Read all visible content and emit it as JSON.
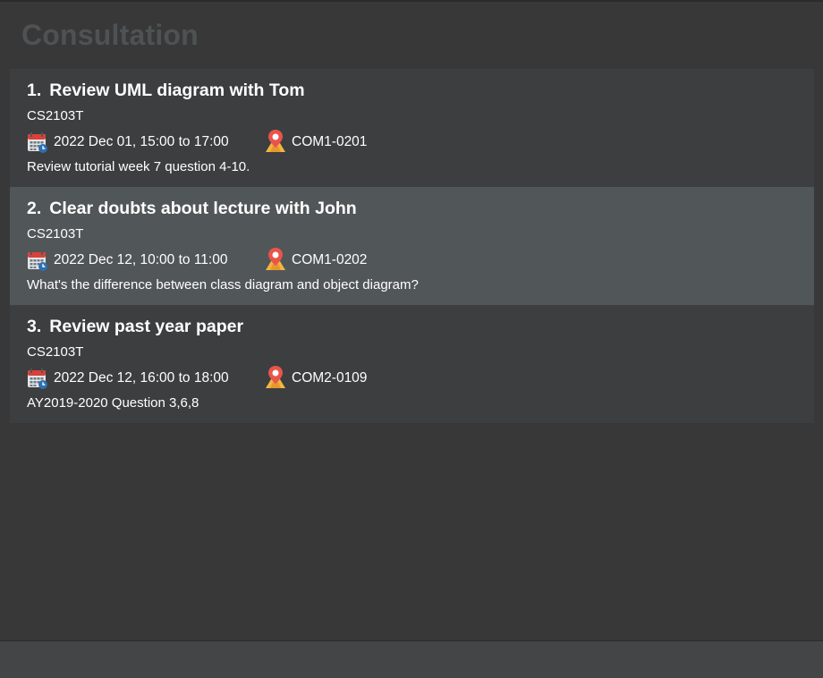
{
  "header": {
    "title": "Consultation"
  },
  "consultations": [
    {
      "index": "1.",
      "title": "Review UML diagram with Tom",
      "module": "CS2103T",
      "datetime": "2022 Dec 01, 15:00 to 17:00",
      "location": "COM1-0201",
      "description": "Review tutorial week 7 question 4-10.",
      "selected": false
    },
    {
      "index": "2.",
      "title": "Clear doubts about lecture with John",
      "module": "CS2103T",
      "datetime": "2022 Dec 12, 10:00 to 11:00",
      "location": "COM1-0202",
      "description": "What's the difference between class diagram and object diagram?",
      "selected": true
    },
    {
      "index": "3.",
      "title": "Review past year paper",
      "module": "CS2103T",
      "datetime": "2022 Dec 12, 16:00 to 18:00",
      "location": "COM2-0109",
      "description": "AY2019-2020 Question 3,6,8",
      "selected": false
    }
  ],
  "icons": {
    "calendar": "calendar-icon",
    "location": "location-pin-icon"
  },
  "colors": {
    "background": "#383838",
    "card": "#3c3e40",
    "card_selected": "#515658",
    "title_text": "#4f5254",
    "text": "#ffffff"
  }
}
